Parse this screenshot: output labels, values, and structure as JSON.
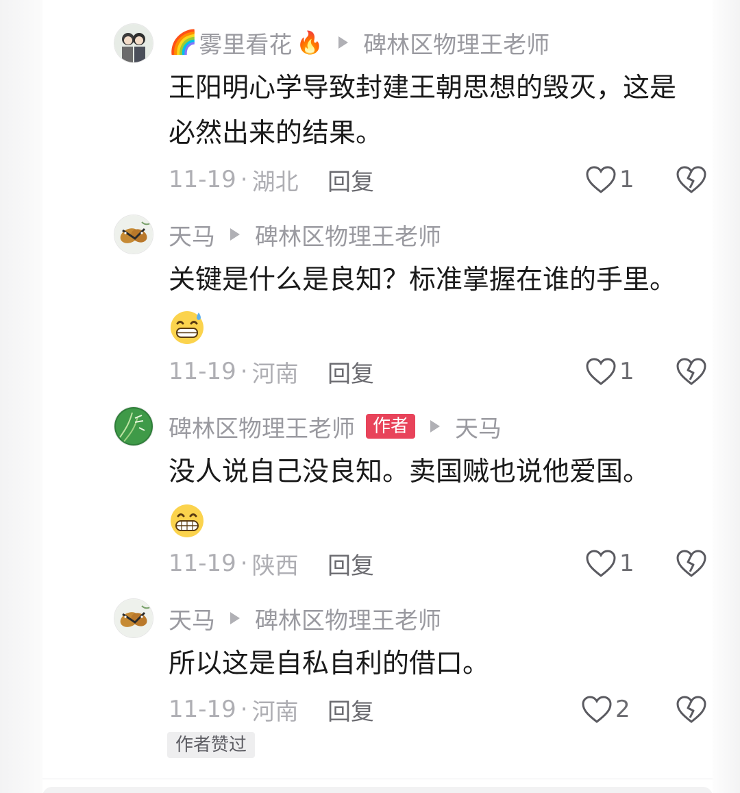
{
  "top_fragment": "·",
  "comments": [
    {
      "name_prefix": "🌈",
      "author": "雾里看花",
      "name_suffix": "🔥",
      "reply_to": "碑林区物理王老师",
      "content": "王阳明心学导致封建王朝思想的毁灭，这是必然出来的结果。",
      "date": "11-19",
      "location": "湖北",
      "reply_label": "回复",
      "likes": "1"
    },
    {
      "author": "天马",
      "reply_to": "碑林区物理王老师",
      "content": "关键是什么是良知？标准掌握在谁的手里。",
      "date": "11-19",
      "location": "河南",
      "reply_label": "回复",
      "likes": "1"
    },
    {
      "author": "碑林区物理王老师",
      "badge": "作者",
      "reply_to": "天马",
      "content": "没人说自己没良知。卖国贼也说他爱国。",
      "date": "11-19",
      "location": "陕西",
      "reply_label": "回复",
      "likes": "1"
    },
    {
      "author": "天马",
      "reply_to": "碑林区物理王老师",
      "content": "所以这是自私自利的借口。",
      "date": "11-19",
      "location": "河南",
      "reply_label": "回复",
      "likes": "2",
      "liked_by_author": "作者赞过"
    }
  ],
  "meta_separator": "·",
  "colors": {
    "badge": "#e8435a",
    "name": "#9a9aa0",
    "text": "#1a1a1a"
  },
  "icons": [
    "heart-outline-icon",
    "broken-heart-icon",
    "reply-arrow-icon",
    "grin-sweat-emoji",
    "grin-emoji"
  ]
}
